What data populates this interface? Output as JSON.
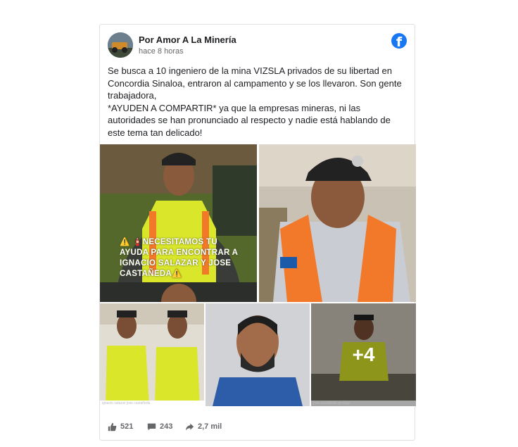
{
  "post": {
    "author": "Por Amor A La Minería",
    "timestamp": "hace 8 horas",
    "text": "Se busca a 10 ingeniero de la mina VIZSLA privados de su libertad en Concordia Sinaloa, entraron al campamento y se los llevaron. Son gente trabajadora,\n*AYUDEN A COMPARTIR* ya que la empresas mineras, ni las autoridades se han pronunciado al respecto y nadie está hablando de este tema tan delicado!",
    "photo1_overlay": "⚠️ 🧯NECESITAMOS TU AYUDA PARA ENCONTRAR A IGNACIO SALAZAR Y JOSE CASTAÑEDA⚠️",
    "more_photos": "+4",
    "photo3_caption": "ignacio salazar jose castañeda",
    "photo5_caption": "jose castañeda geologo",
    "photo2_badge": "MC"
  },
  "footer": {
    "likes": "521",
    "comments": "243",
    "shares": "2,7 mil"
  },
  "colors": {
    "brand": "#1877f2",
    "vest": "#d9e62a",
    "vest_orange": "#f2782a"
  },
  "icons": {
    "facebook": "facebook-logo-icon",
    "like": "thumbs-up-icon",
    "comment": "comment-icon",
    "share": "share-arrow-icon"
  }
}
